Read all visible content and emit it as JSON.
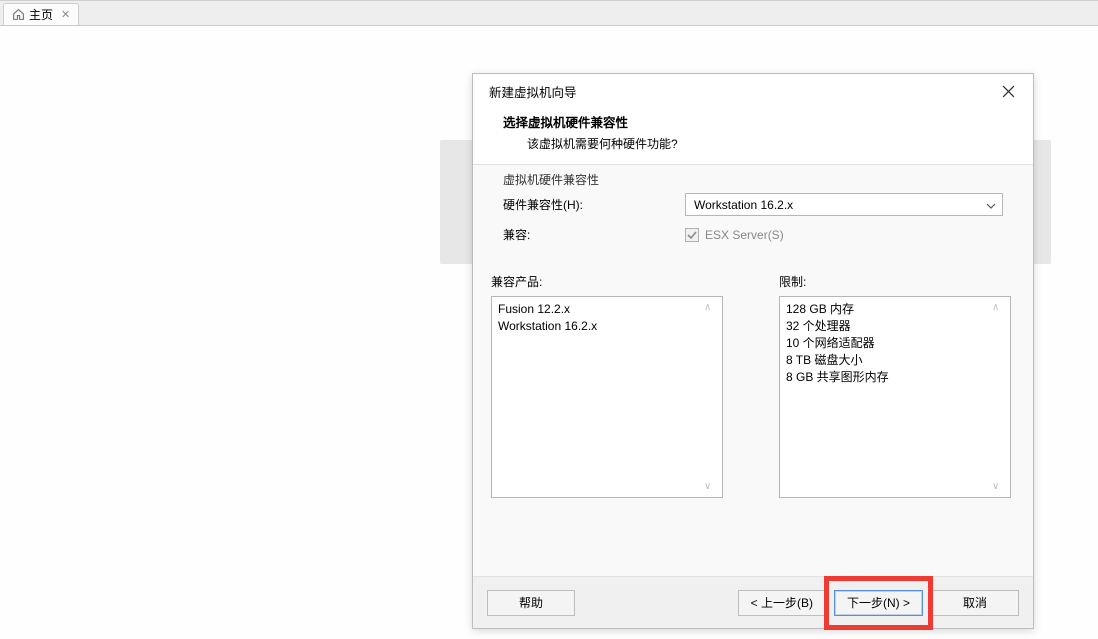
{
  "tab": {
    "label": "主页",
    "close_tooltip": "Close"
  },
  "dialog": {
    "title": "新建虚拟机向导",
    "section_title": "选择虚拟机硬件兼容性",
    "section_desc": "该虚拟机需要何种硬件功能?",
    "group_label": "虚拟机硬件兼容性",
    "compat_label": "硬件兼容性(H):",
    "compat_value": "Workstation 16.2.x",
    "compat_row_label": "兼容:",
    "esx_label": "ESX Server(S)",
    "products_label": "兼容产品:",
    "limits_label": "限制:",
    "products": [
      "Fusion 12.2.x",
      "Workstation 16.2.x"
    ],
    "limits": [
      "128 GB 内存",
      "32 个处理器",
      "10 个网络适配器",
      "8 TB 磁盘大小",
      "8 GB 共享图形内存"
    ],
    "buttons": {
      "help": "帮助",
      "back": "< 上一步(B)",
      "next": "下一步(N) >",
      "cancel": "取消"
    }
  }
}
